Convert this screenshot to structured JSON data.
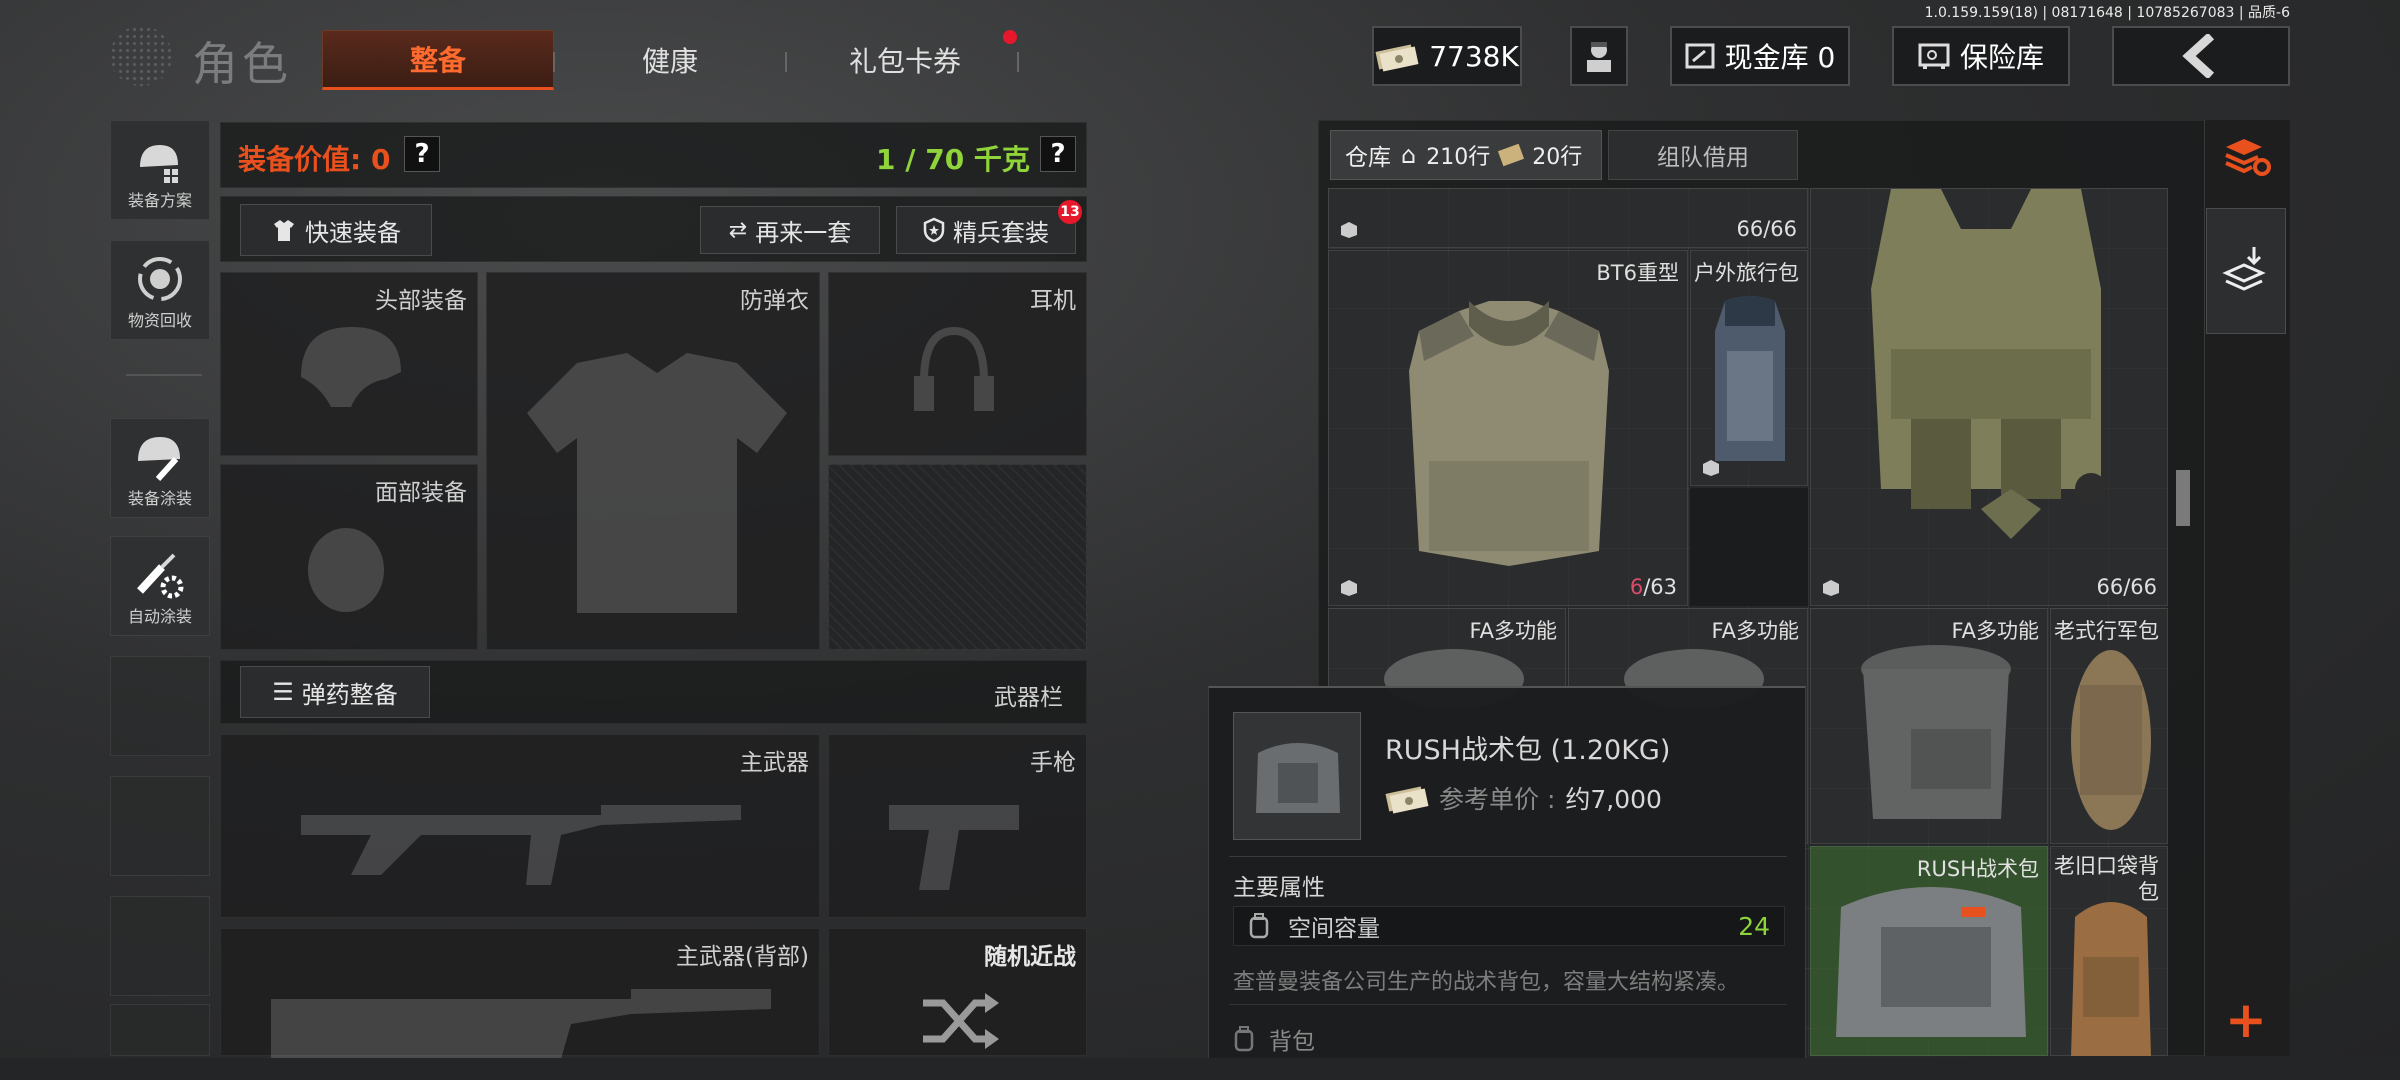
{
  "version_info": "1.0.159.159(18) | 08171648 | 10785267083 | 品质-6",
  "header": {
    "title": "角色",
    "tabs": [
      {
        "label": "整备",
        "active": true
      },
      {
        "label": "健康",
        "active": false
      },
      {
        "label": "礼包卡券",
        "active": false,
        "notification": true
      }
    ],
    "currency": "7738K",
    "cash_vault_label": "现金库 0",
    "safe_label": "保险库"
  },
  "sidebar": {
    "items": [
      {
        "label": "装备方案"
      },
      {
        "label": "物资回收"
      },
      {
        "label": "装备涂装"
      },
      {
        "label": "自动涂装"
      }
    ]
  },
  "loadout": {
    "value_label": "装备价值: 0",
    "weight_label": "1 / 70 千克",
    "quick_equip": "快速装备",
    "re_equip": "再来一套",
    "elite_set": "精兵套装",
    "elite_badge": "13",
    "slots": {
      "head": "头部装备",
      "armor": "防弹衣",
      "headset": "耳机",
      "face": "面部装备",
      "ammo_btn": "弹药整备",
      "weapon_bar": "武器栏",
      "primary": "主武器",
      "pistol": "手枪",
      "primary_back": "主武器(背部)",
      "melee": "随机近战"
    }
  },
  "warehouse": {
    "tab_label": "仓库",
    "rows_a": "210行",
    "rows_b": "20行",
    "team_borrow": "组队借用",
    "items": [
      {
        "name": "",
        "count": "66/66"
      },
      {
        "name": "BT6重型",
        "count_low": "6",
        "count_rest": "/63"
      },
      {
        "name": "户外旅行包",
        "count": ""
      },
      {
        "name": "",
        "count": "66/66"
      },
      {
        "name": "FA多功能"
      },
      {
        "name": "FA多功能"
      },
      {
        "name": "FA多功能"
      },
      {
        "name": "老式行军包"
      },
      {
        "name": "RUSH战术包"
      },
      {
        "name": "老旧口袋背包"
      }
    ]
  },
  "tooltip": {
    "title": "RUSH战术包 (1.20KG)",
    "price_label": "参考单价 :",
    "price_value": "约7,000",
    "section": "主要属性",
    "attr_name": "空间容量",
    "attr_value": "24",
    "description": "查普曼装备公司生产的战术背包，容量大结构紧凑。",
    "category": "背包"
  },
  "colors": {
    "accent_orange": "#e8501e",
    "weight_green": "#8ed43a",
    "low_count_red": "#e04a6a"
  }
}
